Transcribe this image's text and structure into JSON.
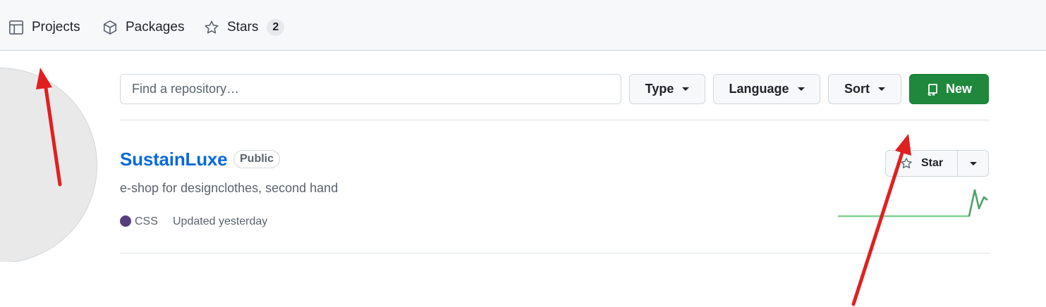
{
  "nav": {
    "items": [
      {
        "label": "Projects",
        "icon": "table-icon"
      },
      {
        "label": "Packages",
        "icon": "package-icon"
      },
      {
        "label": "Stars",
        "icon": "star-icon",
        "count": "2"
      }
    ]
  },
  "filters": {
    "search_placeholder": "Find a repository…",
    "type_label": "Type",
    "language_label": "Language",
    "sort_label": "Sort",
    "new_label": "New"
  },
  "repo": {
    "name": "SustainLuxe",
    "visibility": "Public",
    "description": "e-shop for designclothes, second hand",
    "language": "CSS",
    "language_color": "#563d7c",
    "updated": "Updated yesterday",
    "star_label": "Star"
  },
  "colors": {
    "accent_link": "#0969da",
    "new_button": "#1f883d",
    "annotation_arrow": "#e0201f",
    "sparkline": "#7ed08f"
  }
}
